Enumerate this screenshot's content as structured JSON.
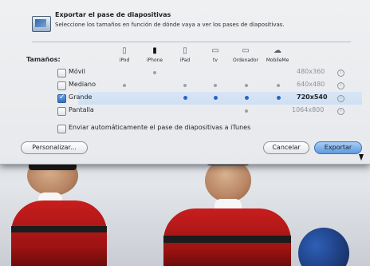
{
  "dialog": {
    "title": "Exportar el pase de diapositivas",
    "subtitle": "Seleccione los tamaños en función de dónde vaya a ver los pases de diapositivas.",
    "sizes_label": "Tamaños:"
  },
  "devices": [
    {
      "label": "iPod",
      "icon": "ipod-icon"
    },
    {
      "label": "iPhone",
      "icon": "iphone-icon"
    },
    {
      "label": "iPad",
      "icon": "ipad-icon"
    },
    {
      "label": "tv",
      "icon": "apple-tv-icon"
    },
    {
      "label": "Ordenador",
      "icon": "computer-icon"
    },
    {
      "label": "MobileMe",
      "icon": "mobileme-icon"
    }
  ],
  "rows": [
    {
      "label": "Móvil",
      "checked": false,
      "resolution": "480x360"
    },
    {
      "label": "Mediano",
      "checked": false,
      "resolution": "640x480"
    },
    {
      "label": "Grande",
      "checked": true,
      "resolution": "720x540"
    },
    {
      "label": "Pantalla",
      "checked": false,
      "resolution": "1064x800"
    }
  ],
  "itunes_option": {
    "label": "Enviar automáticamente el pase de diapositivas a iTunes",
    "checked": false
  },
  "buttons": {
    "personalizar": "Personalizar...",
    "cancelar": "Cancelar",
    "exportar": "Exportar"
  },
  "colors": {
    "selected_row": "#cfe0f3",
    "primary_button": "#5f9be0",
    "dot_selected": "#2b66c6"
  }
}
